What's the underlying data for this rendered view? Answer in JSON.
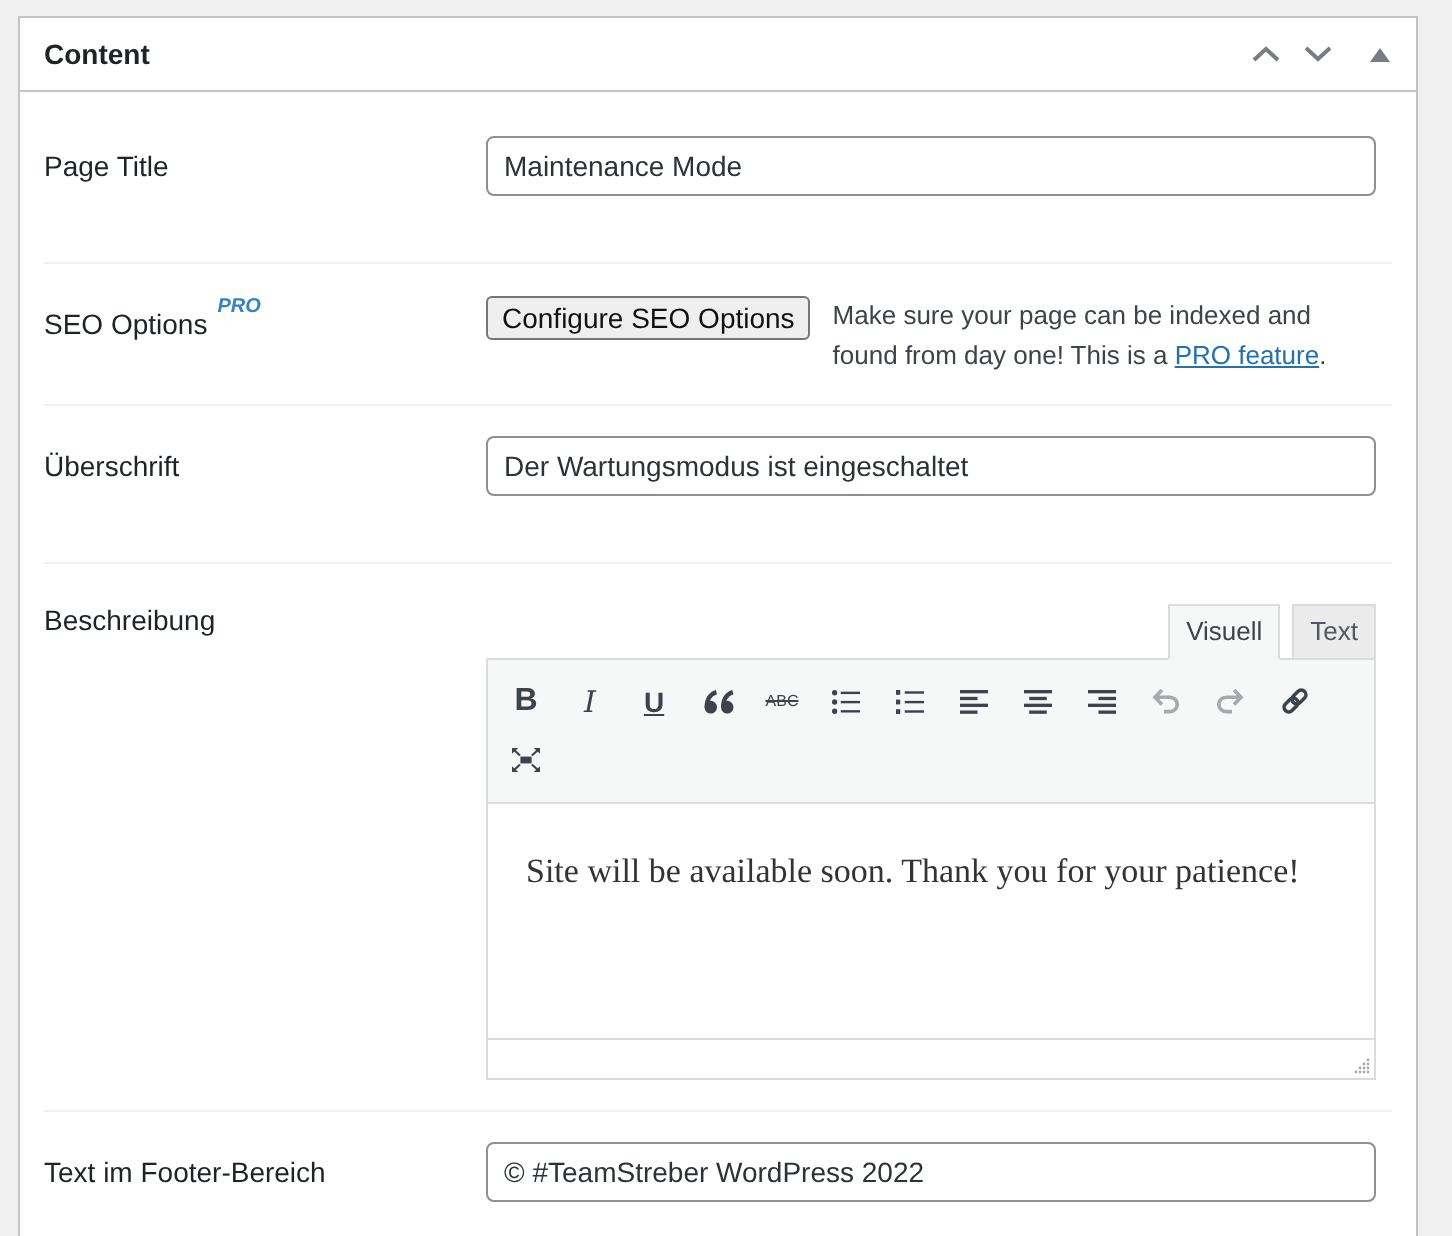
{
  "panel": {
    "title": "Content",
    "expanded": true,
    "controls": [
      {
        "kind": "up"
      },
      {
        "kind": "down"
      },
      {
        "kind": "toggle"
      }
    ]
  },
  "fields": [
    {
      "kind": "text",
      "label": "Page Title",
      "value": "Maintenance Mode"
    },
    {
      "kind": "seo",
      "label": "SEO Options",
      "badge": "PRO",
      "button": "Configure SEO Options",
      "note": "Make sure your page can be indexed and found from day one! This is a ",
      "link": "PRO feature",
      "note_end": "."
    },
    {
      "kind": "text",
      "label": "Überschrift",
      "value": "Der Wartungsmodus ist eingeschaltet"
    },
    {
      "kind": "editor",
      "label": "Beschreibung",
      "tabs": [
        {
          "label": "Visuell",
          "selected": true
        },
        {
          "label": "Text",
          "selected": false
        }
      ],
      "toolbar": [
        {
          "kind": "bold",
          "glyph": "B",
          "disabled": false
        },
        {
          "kind": "italic",
          "glyph": "I",
          "disabled": false
        },
        {
          "kind": "underline",
          "glyph": "U",
          "disabled": false
        },
        {
          "kind": "blockquote",
          "disabled": false
        },
        {
          "kind": "strikethrough",
          "glyph": "ABC",
          "disabled": false
        },
        {
          "kind": "bullets",
          "disabled": false
        },
        {
          "kind": "numbers",
          "disabled": false
        },
        {
          "kind": "alignleft",
          "disabled": false
        },
        {
          "kind": "aligncenter",
          "disabled": false
        },
        {
          "kind": "alignright",
          "disabled": false
        },
        {
          "kind": "undo",
          "disabled": true
        },
        {
          "kind": "redo",
          "disabled": true
        },
        {
          "kind": "link",
          "disabled": false
        },
        {
          "kind": "fullscreen",
          "disabled": false
        }
      ],
      "content": "Site will be available soon. Thank you for your patience!"
    },
    {
      "kind": "text",
      "label": "Text im Footer-Bereich",
      "value": "© #TeamStreber WordPress 2022"
    }
  ]
}
